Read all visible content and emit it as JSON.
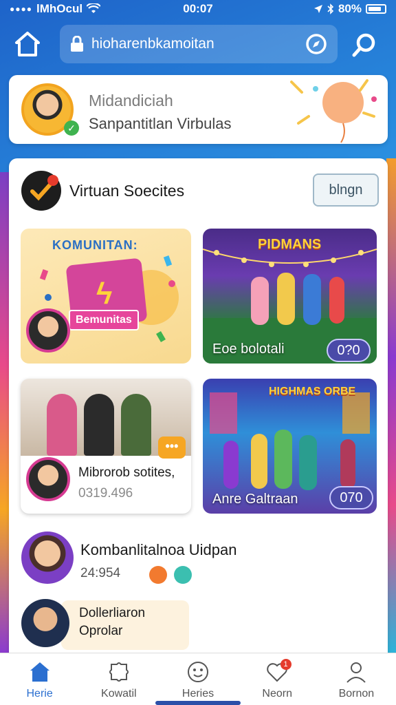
{
  "status": {
    "carrier": "lMhOcul",
    "time": "00:07",
    "battery": "80%"
  },
  "nav": {
    "url": "hioharenbkamoitan"
  },
  "profile": {
    "name": "Midandiciah",
    "subtitle": "Sanpantitlan Virbulas"
  },
  "section": {
    "title": "Virtuan Soecites",
    "button_label": "blngn"
  },
  "tiles": [
    {
      "art_title": "KOMUNITAN:",
      "ribbon": "Bemunitas"
    },
    {
      "art_title": "PIDMANS",
      "caption": "Eoe bolotali",
      "badge": "0?0"
    },
    {
      "title": "Mibrorob sotites,",
      "number": "0319.496",
      "bubble": "•••"
    },
    {
      "art_title": "HIGHMAS ORBE",
      "caption": "Anre Galtraan",
      "badge": "070"
    }
  ],
  "list": [
    {
      "title": "Kombanlitalnoa Uidpan",
      "number": "24:954"
    },
    {
      "title": "Dollerliaron",
      "subtitle": "Oprolar"
    }
  ],
  "tabs": [
    {
      "label": "Herie",
      "icon": "home-icon",
      "active": true
    },
    {
      "label": "Kowatil",
      "icon": "puzzle-icon",
      "active": false
    },
    {
      "label": "Heries",
      "icon": "smiley-icon",
      "active": false
    },
    {
      "label": "Neorn",
      "icon": "heart-icon",
      "active": false,
      "badge": "1"
    },
    {
      "label": "Bornon",
      "icon": "person-icon",
      "active": false
    }
  ],
  "colors": {
    "accent": "#2b6fd0",
    "header_bg": "#1e63c9",
    "badge_red": "#e53b2c"
  }
}
